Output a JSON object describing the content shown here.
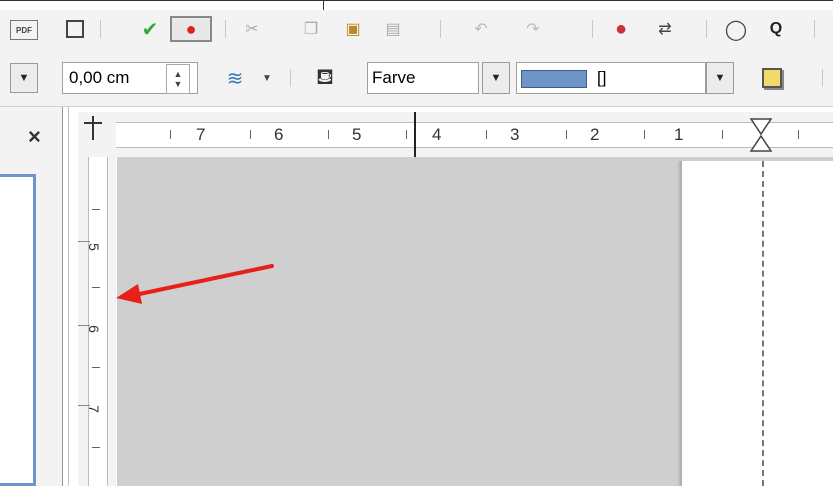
{
  "toolbar2": {
    "spacing_value": "0,00 cm",
    "fill_label": "Farve",
    "color_value": "[]",
    "color_swatch": "#6f95c8"
  },
  "sidebar": {
    "close_label": "×"
  },
  "ruler_horizontal": {
    "labels": [
      "7",
      "6",
      "5",
      "4",
      "3",
      "2",
      "1"
    ]
  },
  "ruler_vertical": {
    "labels": [
      "5",
      "6",
      "7"
    ]
  },
  "annotation": {
    "arrow_color": "#e8201a"
  }
}
